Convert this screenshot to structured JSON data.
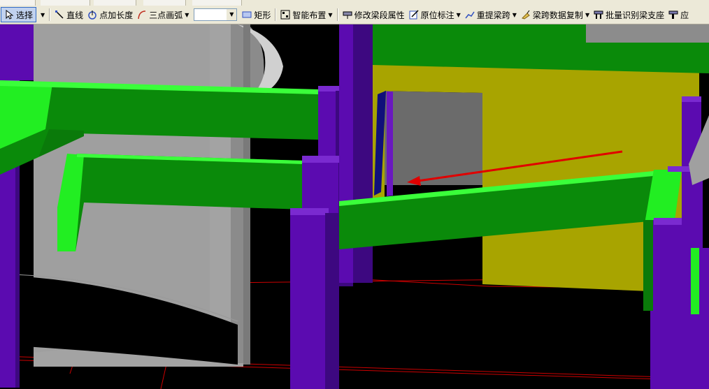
{
  "toolbar": {
    "select_label": "选择",
    "line_label": "直线",
    "point_length_label": "点加长度",
    "arc_label": "三点画弧",
    "arc_select_value": "",
    "rect_label": "矩形",
    "smart_layout_label": "智能布置",
    "modify_beam_label": "修改梁段属性",
    "original_annotation_label": "原位标注",
    "re_extract_span_label": "重提梁跨",
    "copy_span_data_label": "梁跨数据复制",
    "batch_identify_label": "批量识别梁支座",
    "overflow_label": "应"
  },
  "colors": {
    "toolbar_bg": "#ece9d8",
    "beam_green": "#0a8a0a",
    "beam_light_green": "#22ee22",
    "column_purple": "#5b0bb0",
    "wall_yellow": "#a8a400",
    "cylinder_gray": "#a0a0a0",
    "grid_red": "#cc0000",
    "arrow_red": "#e00000"
  },
  "icons": [
    "cursor-icon",
    "line-icon",
    "point-length-icon",
    "arc-icon",
    "rect-icon",
    "smart-layout-icon",
    "beam-attr-icon",
    "annotation-icon",
    "span-icon",
    "copy-icon",
    "support-icon"
  ]
}
